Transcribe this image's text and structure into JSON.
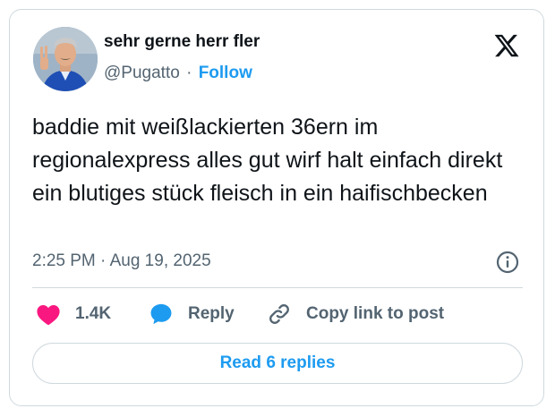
{
  "author": {
    "display_name": "sehr gerne herr fler",
    "handle": "@Pugatto",
    "separator": "·",
    "follow_label": "Follow"
  },
  "tweet": {
    "text": "baddie mit weißlackierten 36ern im regionalexpress alles gut wirf halt einfach direkt ein blutiges stück fleisch in ein haifischbecken",
    "timestamp": "2:25 PM · Aug 19, 2025"
  },
  "actions": {
    "like_count": "1.4K",
    "reply_label": "Reply",
    "copy_link_label": "Copy link to post"
  },
  "read_replies_label": "Read 6 replies",
  "icons": {
    "platform": "x-logo-icon",
    "info": "info-icon",
    "like": "heart-icon",
    "reply": "speech-bubble-icon",
    "copy": "link-icon"
  },
  "colors": {
    "accent": "#1d9bf0",
    "like": "#f91880",
    "secondary_text": "#536471",
    "border": "#cfd9de"
  }
}
